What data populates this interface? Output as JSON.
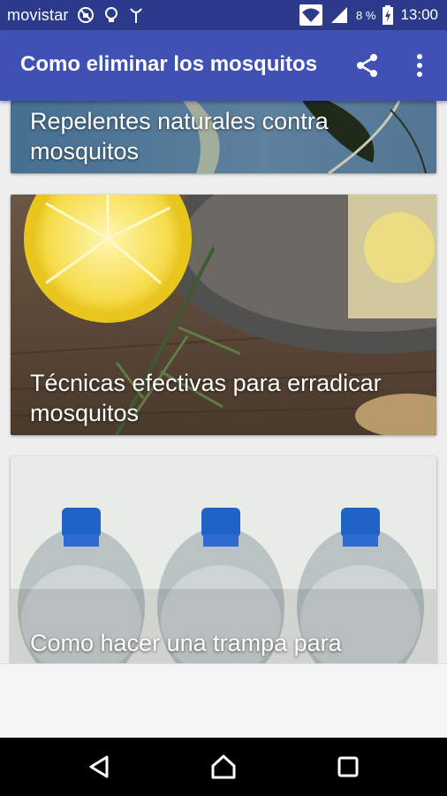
{
  "status_bar": {
    "carrier": "movistar",
    "battery_percent": "8 %",
    "time": "13:00",
    "icons": [
      "no-sim-icon",
      "bulb-icon",
      "antenna-icon",
      "wifi-icon",
      "signal-icon",
      "battery-charging-icon"
    ]
  },
  "toolbar": {
    "title": "Como eliminar los mosquitos",
    "share_icon": "share-icon",
    "more_icon": "more-vert-icon"
  },
  "cards": [
    {
      "title": "Repelentes naturales contra mosquitos"
    },
    {
      "title": "Técnicas efectivas para erradicar mosquitos"
    },
    {
      "title": "Como hacer una trampa para mosquitos"
    }
  ],
  "nav_bar": {
    "icons": [
      "back-icon",
      "home-icon",
      "recents-icon"
    ]
  },
  "colors": {
    "status_bar": "#2c3a8c",
    "toolbar": "#3f51b5",
    "content_bg": "#eeeeee",
    "nav_bar": "#000000"
  }
}
